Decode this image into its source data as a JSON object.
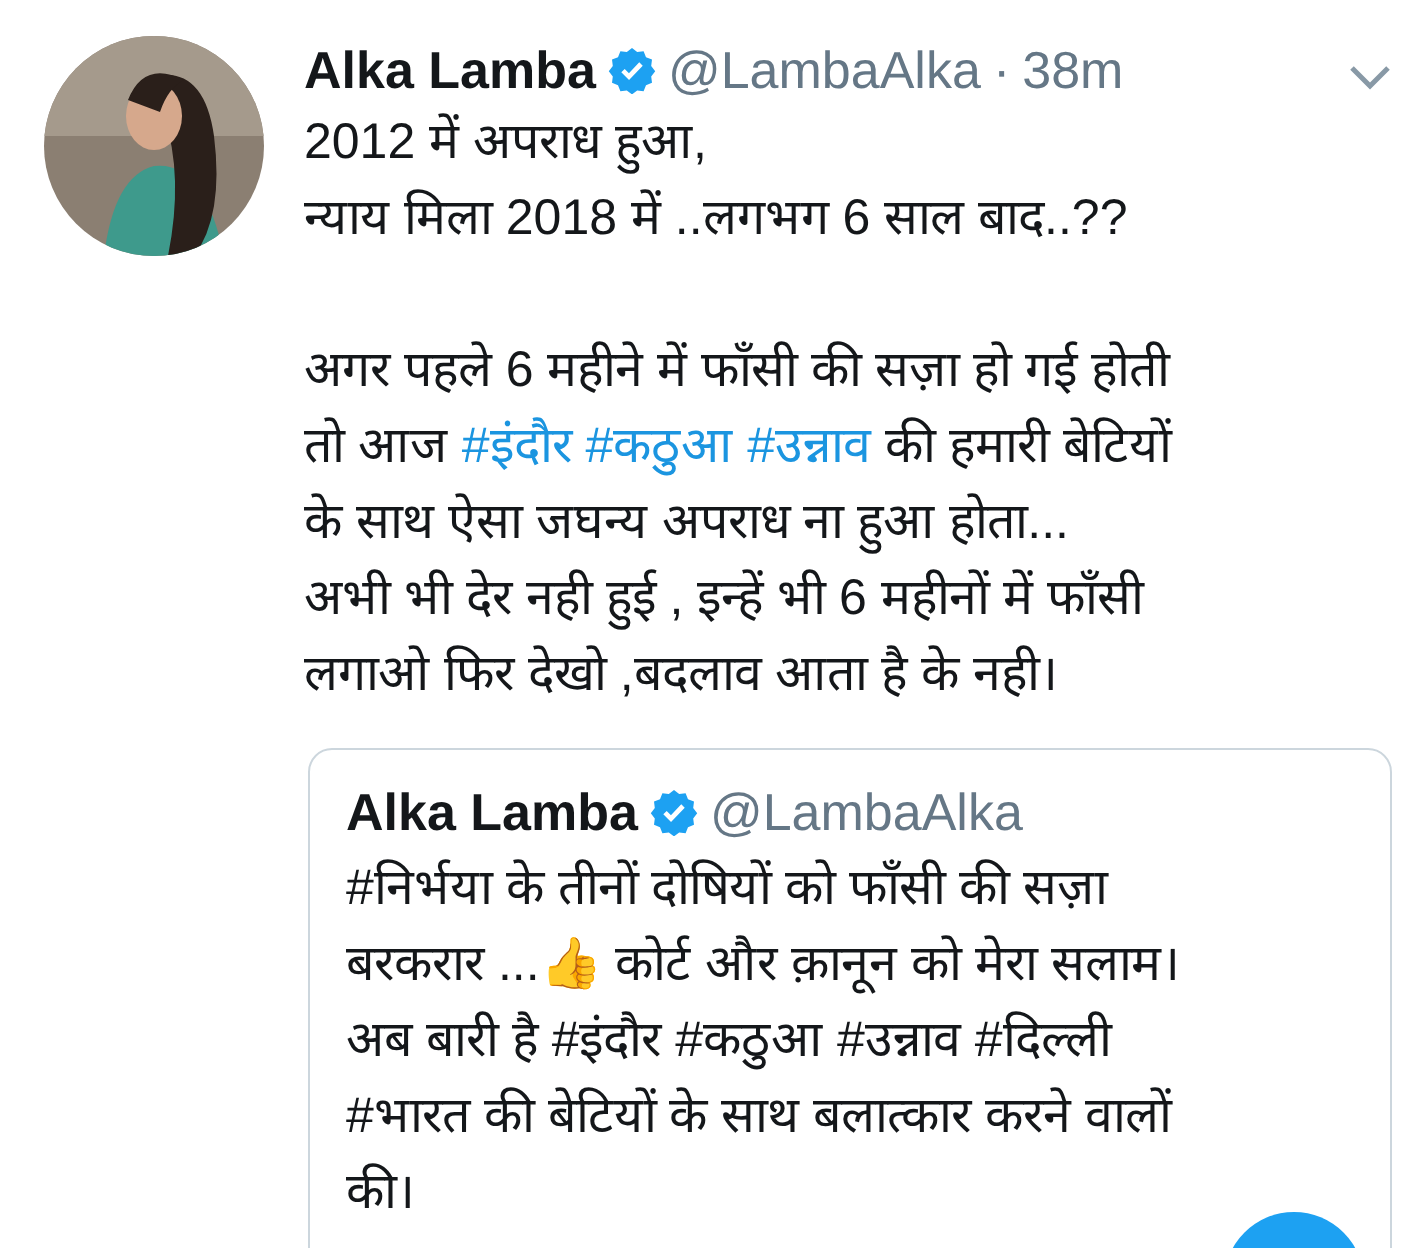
{
  "tweet": {
    "author": {
      "name": "Alka Lamba",
      "verified": true,
      "handle": "@LambaAlka",
      "separator": "·",
      "time": "38m"
    },
    "paragraphs": [
      [
        [
          {
            "kind": "text",
            "text": "2012 में अपराध हुआ,"
          }
        ],
        [
          {
            "kind": "text",
            "text": "न्याय मिला 2018 में ..लगभग 6 साल बाद..??"
          }
        ]
      ],
      [
        [
          {
            "kind": "text",
            "text": "अगर पहले 6 महीने में फाँसी की सज़ा हो गई होती"
          }
        ],
        [
          {
            "kind": "text",
            "text": "तो आज "
          },
          {
            "kind": "hashtag",
            "text": "#इंदौर"
          },
          {
            "kind": "hashtag",
            "text": "#कठुआ"
          },
          {
            "kind": "hashtag",
            "text": "#उन्नाव"
          },
          {
            "kind": "text",
            "text": " की हमारी बेटियों"
          }
        ],
        [
          {
            "kind": "text",
            "text": "के साथ ऐसा जघन्य अपराध ना हुआ होता..."
          }
        ],
        [
          {
            "kind": "text",
            "text": "अभी भी देर नही हुई , इन्हें भी 6 महीनों में फाँसी"
          }
        ],
        [
          {
            "kind": "text",
            "text": "लगाओ फिर देखो ,बदलाव आता है के नही।"
          }
        ]
      ]
    ],
    "quoted": {
      "author": {
        "name": "Alka Lamba",
        "verified": true,
        "handle": "@LambaAlka"
      },
      "lines": [
        "#निर्भया के तीनों दोषियों को फाँसी की सज़ा",
        "बरकरार  ...👍 कोर्ट और क़ानून को मेरा सलाम।",
        "अब बारी है #इंदौर #कठुआ #उन्नाव #दिल्ली",
        "#भारत की बेटियों के साथ बलात्कार करने वालों",
        "की।"
      ]
    }
  }
}
